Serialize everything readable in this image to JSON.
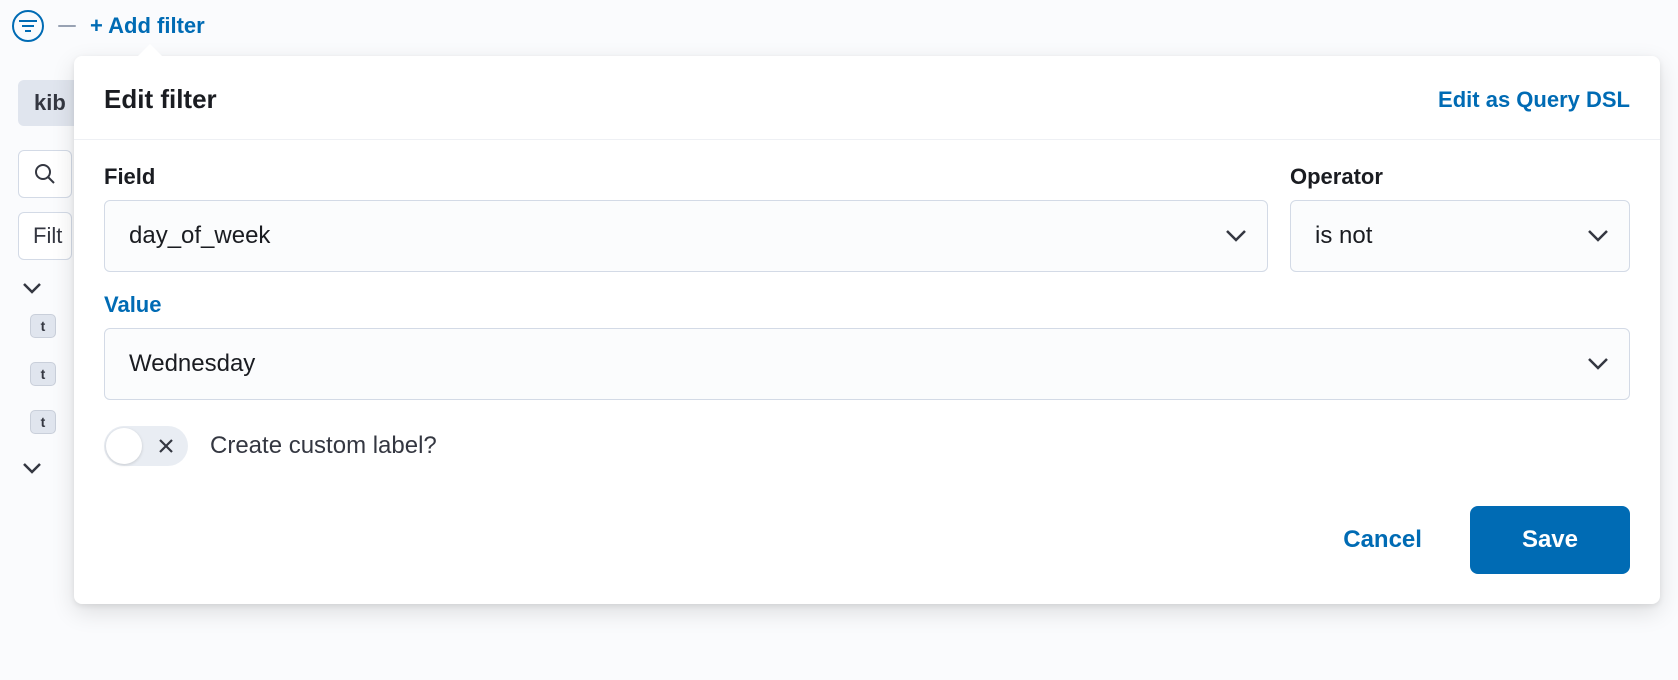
{
  "topbar": {
    "add_filter_label": "+ Add filter"
  },
  "side": {
    "chip_label": "kib",
    "filter_box_text": "Filt",
    "badge_t": "t"
  },
  "popover": {
    "title": "Edit filter",
    "query_dsl_link": "Edit as Query DSL",
    "field_label": "Field",
    "field_value": "day_of_week",
    "operator_label": "Operator",
    "operator_value": "is not",
    "value_label": "Value",
    "value_value": "Wednesday",
    "toggle_label": "Create custom label?",
    "cancel_label": "Cancel",
    "save_label": "Save"
  }
}
